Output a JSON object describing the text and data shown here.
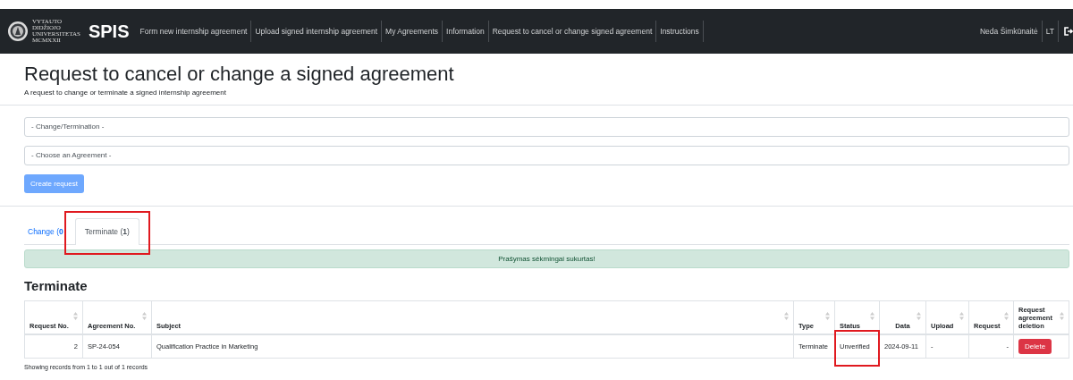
{
  "navbar": {
    "logo_lines": [
      "VYTAUTO",
      "DIDŽIOJO",
      "UNIVERSITETAS",
      "MCMXXII"
    ],
    "brand": "SPIS",
    "links": [
      {
        "label": "Form new internship agreement"
      },
      {
        "label": "Upload signed internship agreement"
      },
      {
        "label": "My Agreements"
      },
      {
        "label": "Information"
      },
      {
        "label": "Request to cancel or change signed agreement"
      },
      {
        "label": "Instructions"
      }
    ],
    "user": "Neda Šimkūnaitė",
    "language": "LT"
  },
  "page": {
    "title": "Request to cancel or change a signed agreement",
    "subtitle": "A request to change or terminate a signed internship agreement"
  },
  "form": {
    "selects": [
      {
        "value": "- Change/Termination -"
      },
      {
        "value": "- Choose an Agreement -"
      }
    ],
    "button": "Create request"
  },
  "tabs": [
    {
      "label": "Change (",
      "count": "0",
      "selected": false,
      "annotated": false
    },
    {
      "label": "Terminate (",
      "count": "1",
      "suffix": ")",
      "selected": true,
      "annotated": true
    }
  ],
  "alert": "Prašymas sėkmingai sukurtas!",
  "section_title": "Terminate",
  "table": {
    "columns": [
      {
        "label": "Request No."
      },
      {
        "label": "Agreement No."
      },
      {
        "label": "Subject"
      },
      {
        "label": "Type"
      },
      {
        "label": "Status"
      },
      {
        "label": "Data"
      },
      {
        "label": "Upload"
      },
      {
        "label": "Request"
      },
      {
        "label": "Request agreement deletion"
      }
    ],
    "rows": [
      {
        "cells": [
          {
            "text": "2"
          },
          {
            "text": "SP-24-054"
          },
          {
            "text": "Qualification Practice in Marketing"
          },
          {
            "text": "Terminate"
          },
          {
            "text": "Unverified",
            "annotated": true
          },
          {
            "text": "2024-09-11"
          },
          {
            "text": "-"
          },
          {
            "text": "-"
          },
          {
            "kind": "button",
            "text": "Delete"
          }
        ]
      }
    ]
  },
  "footer": "Showing records from 1 to 1 out of 1 records"
}
